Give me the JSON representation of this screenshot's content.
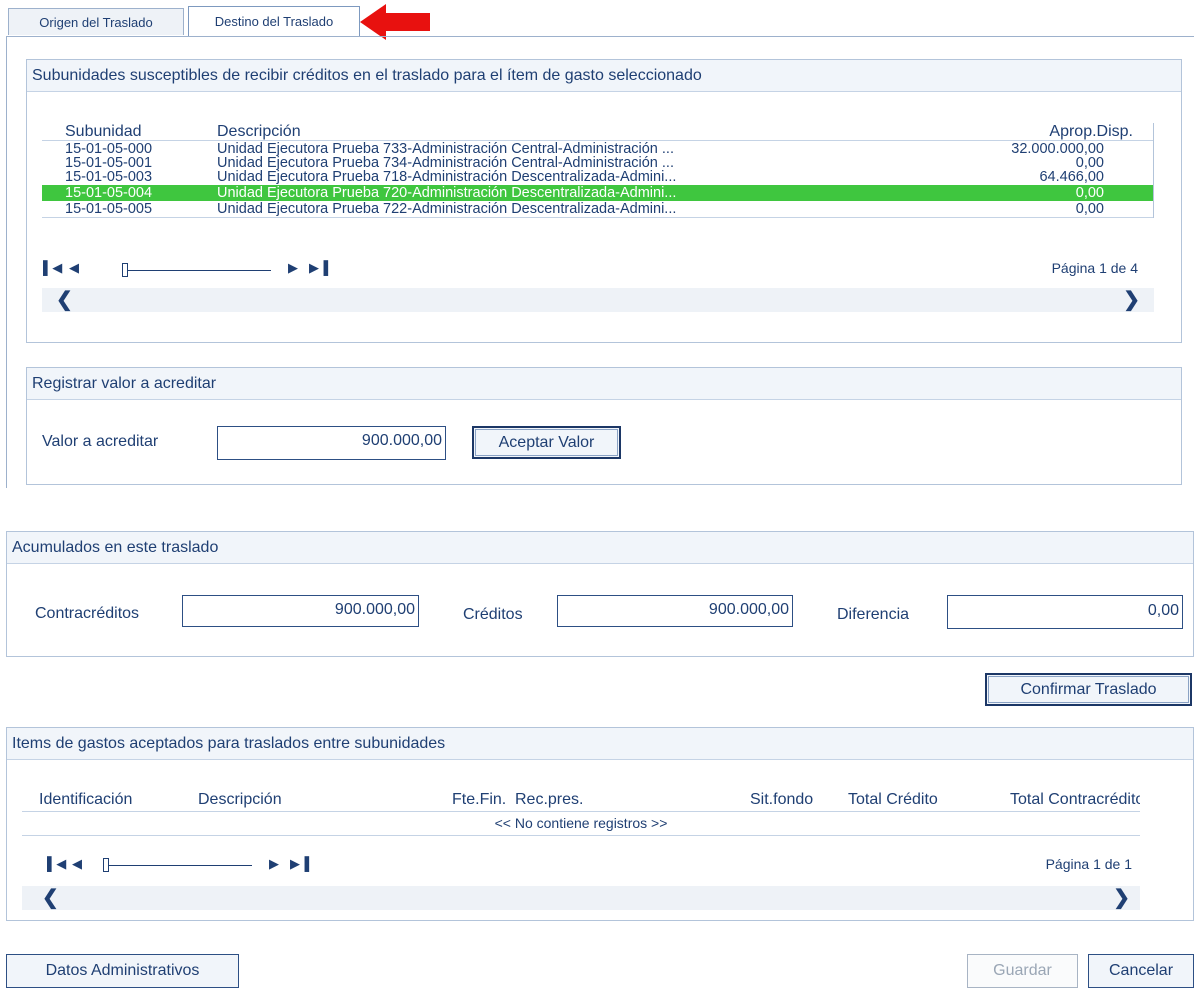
{
  "tabs": [
    {
      "label": "Origen del Traslado",
      "active": false
    },
    {
      "label": "Destino del Traslado",
      "active": true
    }
  ],
  "annotation": {
    "icon": "red-arrow-icon",
    "color": "#e8110f"
  },
  "subunidades": {
    "title": "Subunidades susceptibles de recibir créditos en el traslado para el ítem de gasto seleccionado",
    "columns": {
      "subunidad": "Subunidad",
      "descripcion": "Descripción",
      "aprop": "Aprop.Disp."
    },
    "rows": [
      {
        "subunidad": "15-01-05-000",
        "descripcion": "Unidad Ejecutora Prueba 733-Administración Central-Administración ...",
        "aprop": "32.000.000,00",
        "selected": false
      },
      {
        "subunidad": "15-01-05-001",
        "descripcion": "Unidad Ejecutora Prueba 734-Administración Central-Administración ...",
        "aprop": "0,00",
        "selected": false
      },
      {
        "subunidad": "15-01-05-003",
        "descripcion": "Unidad Ejecutora Prueba 718-Administración Descentralizada-Admini...",
        "aprop": "64.466,00",
        "selected": false
      },
      {
        "subunidad": "15-01-05-004",
        "descripcion": "Unidad Ejecutora Prueba 720-Administración Descentralizada-Admini...",
        "aprop": "0,00",
        "selected": true
      },
      {
        "subunidad": "15-01-05-005",
        "descripcion": "Unidad Ejecutora Prueba 722-Administración Descentralizada-Admini...",
        "aprop": "0,00",
        "selected": false
      }
    ],
    "page": "Página 1 de 4",
    "selected_color": "#3fc63f"
  },
  "registrar": {
    "title": "Registrar valor a acreditar",
    "label": "Valor a acreditar",
    "value": "900.000,00",
    "button": "Aceptar Valor"
  },
  "acumulados": {
    "title": "Acumulados en este traslado",
    "contracreditos_label": "Contracréditos",
    "contracreditos_value": "900.000,00",
    "creditos_label": "Créditos",
    "creditos_value": "900.000,00",
    "diferencia_label": "Diferencia",
    "diferencia_value": "0,00"
  },
  "confirmar_button": "Confirmar Traslado",
  "items": {
    "title": "Items de gastos aceptados para traslados entre subunidades",
    "columns": {
      "identificacion": "Identificación",
      "descripcion": "Descripción",
      "ftefin": "Fte.Fin.",
      "recpres": "Rec.pres.",
      "sitfondo": "Sit.fondo",
      "total_credito": "Total Crédito",
      "total_contracredito": "Total Contracrédito"
    },
    "empty": "<< No contiene registros >>",
    "page": "Página 1 de 1"
  },
  "footer": {
    "datos_button": "Datos Administrativos",
    "guardar_button": "Guardar",
    "cancelar_button": "Cancelar"
  }
}
